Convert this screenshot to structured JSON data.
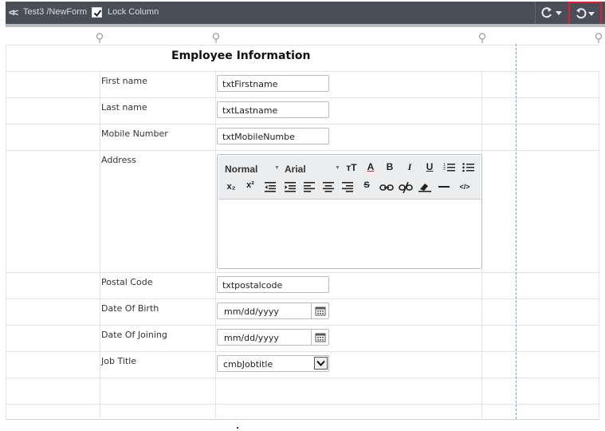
{
  "toolbar": {
    "back_icon": "double-chevron-left-icon",
    "path": "Test3 /NewForm",
    "lock_column_label": "Lock Column",
    "lock_column_checked": true,
    "redo_icon": "redo-dropdown-icon",
    "undo_icon": "undo-dropdown-icon",
    "highlight_color": "#e0202a"
  },
  "form": {
    "title": "Employee Information",
    "fields": {
      "first_name": {
        "label": "First name",
        "value": "txtFirstname"
      },
      "last_name": {
        "label": "Last name",
        "value": "txtLastname"
      },
      "mobile": {
        "label": "Mobile Number",
        "value": "txtMobileNumbe"
      },
      "address": {
        "label": "Address"
      },
      "postal": {
        "label": "Postal Code",
        "value": "txtpostalcode"
      },
      "dob": {
        "label": "Date Of Birth",
        "placeholder": "mm/dd/yyyy"
      },
      "doj": {
        "label": "Date Of Joining",
        "placeholder": "mm/dd/yyyy"
      },
      "job_title": {
        "label": "Job Title",
        "selected": "cmbJobtitle"
      }
    },
    "editor": {
      "format_value": "Normal",
      "font_value": "Arial",
      "buttons_row1": [
        "text-size-icon",
        "font-color-icon",
        "bold-icon",
        "italic-icon",
        "underline-icon",
        "ordered-list-icon",
        "unordered-list-icon"
      ],
      "buttons_row2": [
        "subscript-icon",
        "superscript-icon",
        "outdent-icon",
        "indent-icon",
        "align-left-icon",
        "align-center-icon",
        "align-right-icon",
        "strikethrough-icon",
        "link-icon",
        "unlink-icon",
        "eraser-icon",
        "horizontal-rule-icon",
        "source-code-icon"
      ],
      "labels": {
        "bold": "B",
        "italic": "I",
        "underline": "U",
        "font_color": "A",
        "text_size": "тТ",
        "subscript": "x₂",
        "superscript": "x²",
        "strike": "S",
        "code": "</>"
      }
    }
  },
  "colors": {
    "toolbar_bg": "#4a4f57",
    "guide_line": "#6a9ef0"
  }
}
